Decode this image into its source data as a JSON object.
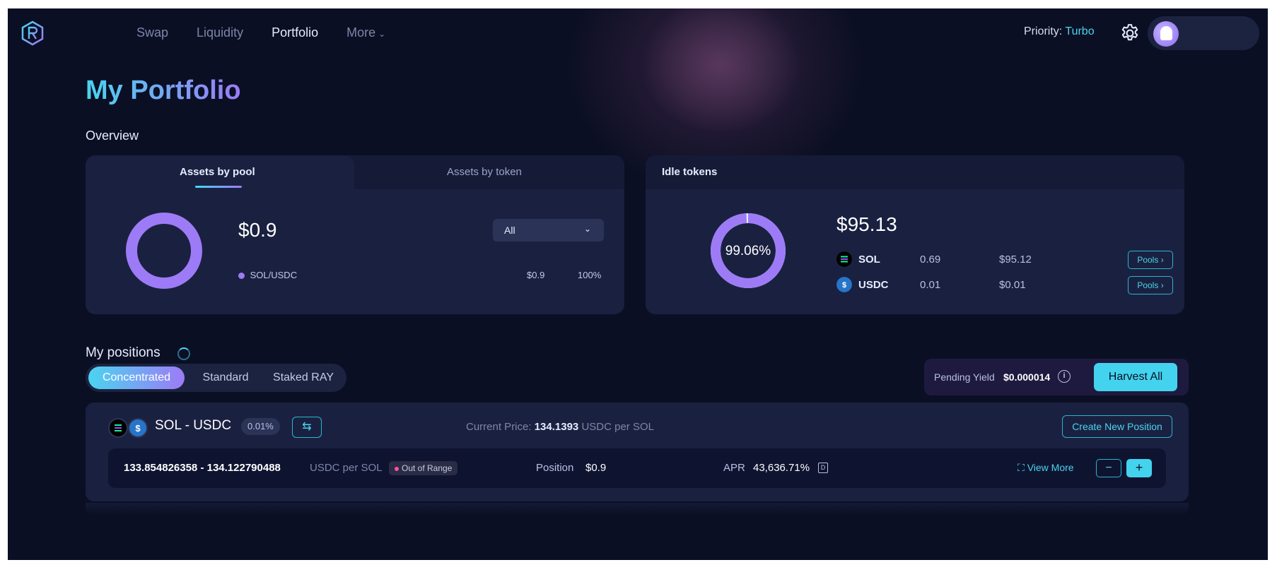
{
  "nav": {
    "items": [
      {
        "label": "Swap"
      },
      {
        "label": "Liquidity"
      },
      {
        "label": "Portfolio"
      },
      {
        "label": "More"
      }
    ],
    "active": "Portfolio",
    "priority_label": "Priority:",
    "priority_value": "Turbo"
  },
  "page": {
    "title": "My Portfolio",
    "overview_label": "Overview"
  },
  "assets_card": {
    "tabs": [
      "Assets by pool",
      "Assets by token"
    ],
    "active_tab": "Assets by pool",
    "total": "$0.9",
    "filter_value": "All",
    "legend": [
      {
        "name": "SOL/USDC",
        "value": "$0.9",
        "percent": "100%",
        "color": "#9d7bf7",
        "share": 1.0
      }
    ]
  },
  "idle_card": {
    "title": "Idle tokens",
    "total": "$95.13",
    "donut_label": "99.06%",
    "donut_share": 0.9906,
    "tokens": [
      {
        "symbol": "SOL",
        "amount": "0.69",
        "usd": "$95.12",
        "button": "Pools"
      },
      {
        "symbol": "USDC",
        "amount": "0.01",
        "usd": "$0.01",
        "button": "Pools"
      }
    ]
  },
  "positions": {
    "title": "My positions",
    "segments": [
      "Concentrated",
      "Standard",
      "Staked RAY"
    ],
    "active_segment": "Concentrated",
    "pending_yield_label": "Pending Yield",
    "pending_yield_value": "$0.000014",
    "harvest_label": "Harvest All",
    "pool": {
      "pair": "SOL - USDC",
      "fee": "0.01%",
      "current_price_label": "Current Price:",
      "current_price_value": "134.1393",
      "current_price_unit": "USDC per SOL",
      "create_label": "Create New Position",
      "row": {
        "range": "133.854826358 - 134.122790488",
        "range_unit": "USDC per SOL",
        "status": "Out of Range",
        "position_label": "Position",
        "position_value": "$0.9",
        "apr_label": "APR",
        "apr_value": "43,636.71%",
        "view_more_label": "View More",
        "minus": "−",
        "plus": "+"
      }
    }
  },
  "colors": {
    "accent": "#4ad4ef",
    "purple": "#9d7bf7",
    "background": "#0b0f24",
    "card": "#1a2140"
  }
}
